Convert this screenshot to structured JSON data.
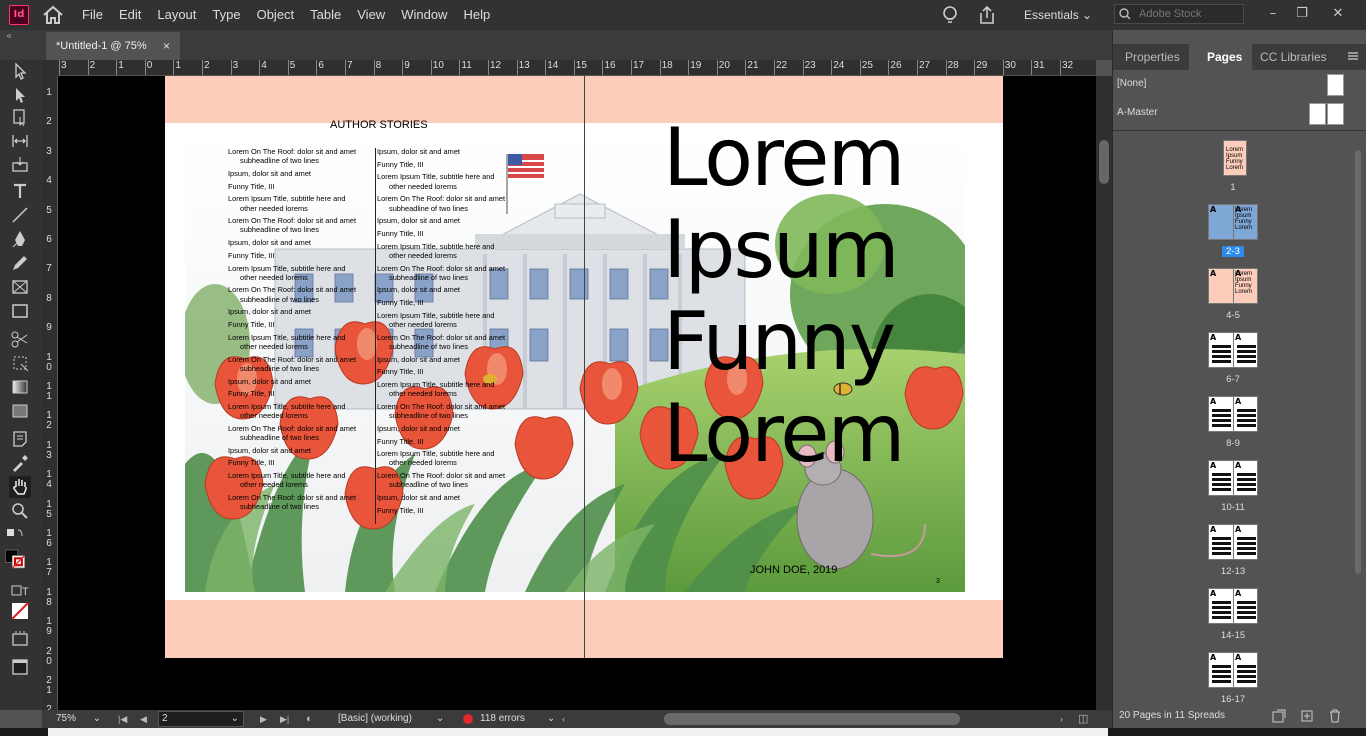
{
  "app": {
    "logo": "Id",
    "workspace": "Essentials",
    "stock_placeholder": "Adobe Stock"
  },
  "menus": [
    "File",
    "Edit",
    "Layout",
    "Type",
    "Object",
    "Table",
    "View",
    "Window",
    "Help"
  ],
  "window_controls": {
    "minimize": "–",
    "restore": "❐",
    "close": "✕"
  },
  "toolbar_top": "«",
  "document_tab": {
    "title": "*Untitled-1 @ 75%",
    "close": "×"
  },
  "ruler": {
    "h_numbers": [
      "3",
      "2",
      "1",
      "0",
      "1",
      "2",
      "3",
      "4",
      "5",
      "6",
      "7",
      "8",
      "9",
      "10",
      "11",
      "12",
      "13",
      "14",
      "15",
      "16",
      "17",
      "18",
      "19",
      "20",
      "21",
      "22",
      "23",
      "24",
      "25",
      "26",
      "27",
      "28",
      "29",
      "30",
      "31",
      "32"
    ],
    "v_numbers": [
      "1",
      "2",
      "3",
      "4",
      "5",
      "6",
      "7",
      "8",
      "9",
      "1 0",
      "1 1",
      "1 2",
      "1 3",
      "1 4",
      "1 5",
      "1 6",
      "1 7",
      "1 8",
      "1 9",
      "2 0",
      "2 1",
      "2 2"
    ]
  },
  "spread": {
    "left_heading": "AUTHOR STORIES",
    "toc_left": [
      {
        "title": "Lorem On The Roof: dolor sit and amet",
        "sub": "subheadline of two lines"
      },
      {
        "title": "Ipsum, dolor sit and amet",
        "sub": ""
      },
      {
        "title": "Funny Title, III",
        "sub": ""
      },
      {
        "title": "Lorem Ipsum Title, subtitle here and",
        "sub": "other needed lorems"
      },
      {
        "title": "Lorem On The Roof: dolor sit and amet",
        "sub": "subheadline of two lines"
      },
      {
        "title": "Ipsum, dolor sit and amet",
        "sub": ""
      },
      {
        "title": "Funny Title, III",
        "sub": ""
      },
      {
        "title": "Lorem Ipsum Title, subtitle here and",
        "sub": "other needed lorems"
      },
      {
        "title": "Lorem On The Roof: dolor sit and amet",
        "sub": "subheadline of two lines"
      },
      {
        "title": "Ipsum, dolor sit and amet",
        "sub": ""
      },
      {
        "title": "Funny Title, III",
        "sub": ""
      },
      {
        "title": "Lorem Ipsum Title, subtitle here and",
        "sub": "other needed lorems"
      },
      {
        "title": "Lorem On The Roof: dolor sit and amet",
        "sub": "subheadline of two lines"
      },
      {
        "title": "Ipsum, dolor sit and amet",
        "sub": ""
      },
      {
        "title": "Funny Title, III",
        "sub": ""
      },
      {
        "title": "Lorem Ipsum Title, subtitle here and",
        "sub": "other needed lorems"
      },
      {
        "title": "Lorem On The Roof: dolor sit and amet",
        "sub": "subheadline of two lines"
      },
      {
        "title": "Ipsum, dolor sit and amet",
        "sub": ""
      },
      {
        "title": "Funny Title, III",
        "sub": ""
      },
      {
        "title": "Lorem Ipsum Title, subtitle here and",
        "sub": "other needed lorems"
      },
      {
        "title": "Lorem On The Roof: dolor sit and amet",
        "sub": "subheadline of two lines"
      }
    ],
    "toc_right": [
      {
        "title": "Ipsum, dolor sit and amet",
        "sub": ""
      },
      {
        "title": "Funny Title, III",
        "sub": ""
      },
      {
        "title": "Lorem Ipsum Title, subtitle here and",
        "sub": "other needed lorems"
      },
      {
        "title": "Lorem On The Roof: dolor sit and amet",
        "sub": "subheadline of two lines"
      },
      {
        "title": "Ipsum, dolor sit and amet",
        "sub": ""
      },
      {
        "title": "Funny Title, III",
        "sub": ""
      },
      {
        "title": "Lorem Ipsum Title, subtitle here and",
        "sub": "other needed lorems"
      },
      {
        "title": "Lorem On The Roof: dolor sit and amet",
        "sub": "subheadline of two lines"
      },
      {
        "title": "Ipsum, dolor sit and amet",
        "sub": ""
      },
      {
        "title": "Funny Title, III",
        "sub": ""
      },
      {
        "title": "Lorem Ipsum Title, subtitle here and",
        "sub": "other needed lorems"
      },
      {
        "title": "Lorem On The Roof: dolor sit and amet",
        "sub": "subheadline of two lines"
      },
      {
        "title": "Ipsum, dolor sit and amet",
        "sub": ""
      },
      {
        "title": "Funny Title, III",
        "sub": ""
      },
      {
        "title": "Lorem Ipsum Title, subtitle here and",
        "sub": "other needed lorems"
      },
      {
        "title": "Lorem On The Roof: dolor sit and amet",
        "sub": "subheadline of two lines"
      },
      {
        "title": "Ipsum, dolor sit and amet",
        "sub": ""
      },
      {
        "title": "Funny Title, III",
        "sub": ""
      },
      {
        "title": "Lorem Ipsum Title, subtitle here and",
        "sub": "other needed lorems"
      },
      {
        "title": "Lorem On The Roof: dolor sit and amet",
        "sub": "subheadline of two lines"
      },
      {
        "title": "Ipsum, dolor sit and amet",
        "sub": ""
      },
      {
        "title": "Funny Title, III",
        "sub": ""
      }
    ],
    "title_lines": [
      "Lorem",
      "Ipsum",
      "Funny",
      "Lorem"
    ],
    "author_date": "JOHN DOE, 2019",
    "page_number": "3"
  },
  "statusbar": {
    "zoom": "75%",
    "page": "2",
    "preflight_profile": "[Basic] (working)",
    "errors": "118 errors"
  },
  "panel": {
    "tabs": [
      "Properties",
      "Pages",
      "CC Libraries"
    ],
    "active_tab": "Pages",
    "masters": [
      {
        "label": "[None]"
      },
      {
        "label": "A-Master"
      }
    ],
    "spreads": [
      {
        "label": "1"
      },
      {
        "label": "2-3",
        "selected": true
      },
      {
        "label": "4-5"
      },
      {
        "label": "6-7"
      },
      {
        "label": "8-9"
      },
      {
        "label": "10-11"
      },
      {
        "label": "12-13"
      },
      {
        "label": "14-15"
      },
      {
        "label": "16-17"
      }
    ],
    "master_prefix": "A",
    "thumb_text": [
      "Lorem",
      "Ipsum",
      "Funny",
      "Lorem"
    ],
    "footer": "20 Pages in 11 Spreads"
  },
  "colors": {
    "bleed": "#fccdbb",
    "selected": "#2d8ceb",
    "error": "#e0282e",
    "logo": "#ff3366"
  }
}
